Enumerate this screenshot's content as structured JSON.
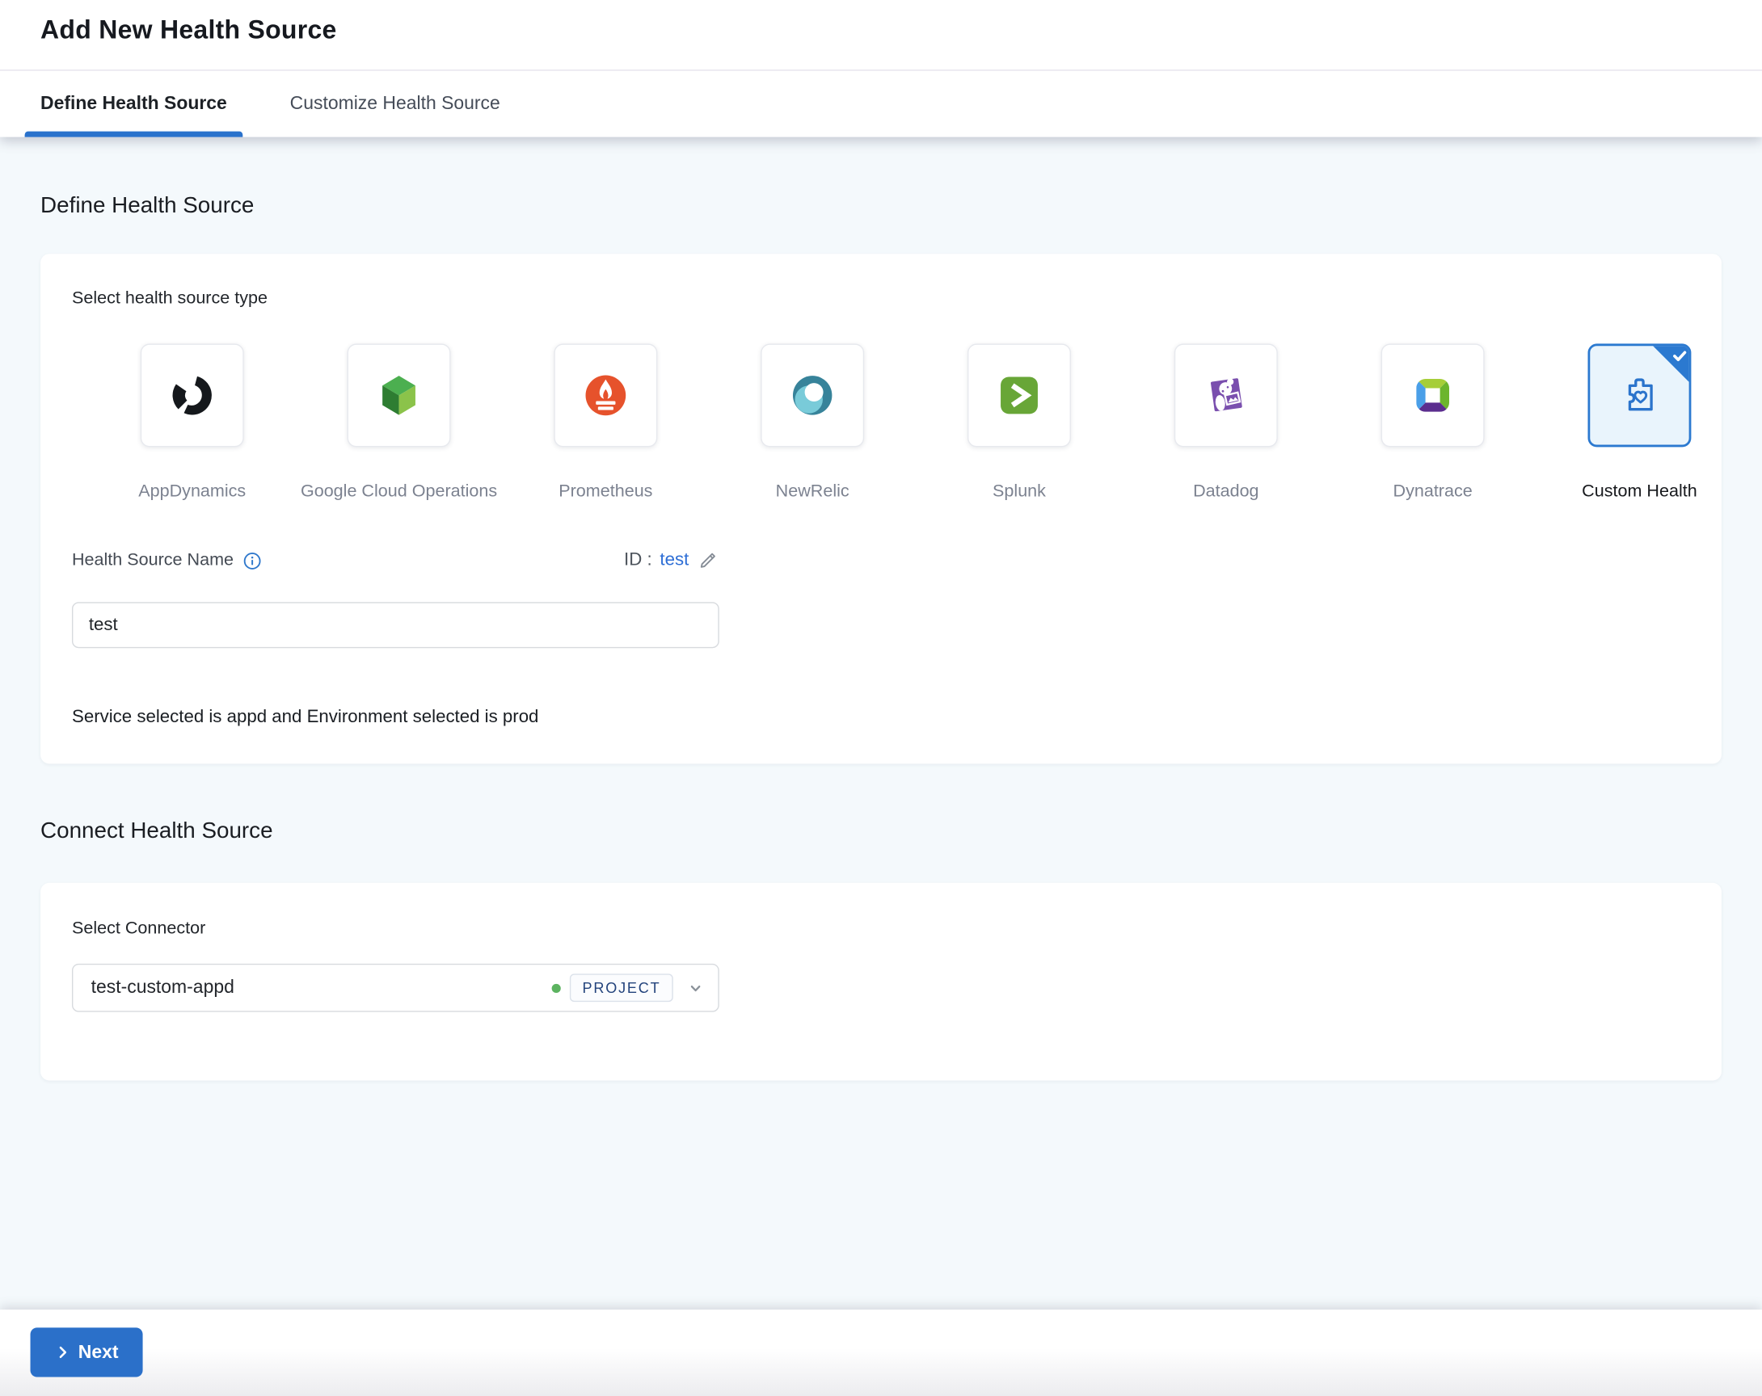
{
  "header": {
    "title": "Add New Health Source",
    "tabs": [
      {
        "label": "Define Health Source",
        "active": true
      },
      {
        "label": "Customize Health Source",
        "active": false
      }
    ]
  },
  "define_section": {
    "heading": "Define Health Source",
    "select_type_label": "Select health source type",
    "source_types": [
      {
        "label": "AppDynamics",
        "icon": "appdynamics-icon",
        "selected": false
      },
      {
        "label": "Google Cloud Operations",
        "icon": "google-cloud-operations-icon",
        "selected": false
      },
      {
        "label": "Prometheus",
        "icon": "prometheus-icon",
        "selected": false
      },
      {
        "label": "NewRelic",
        "icon": "newrelic-icon",
        "selected": false
      },
      {
        "label": "Splunk",
        "icon": "splunk-icon",
        "selected": false
      },
      {
        "label": "Datadog",
        "icon": "datadog-icon",
        "selected": false
      },
      {
        "label": "Dynatrace",
        "icon": "dynatrace-icon",
        "selected": false
      },
      {
        "label": "Custom Health",
        "icon": "custom-health-icon",
        "selected": true
      }
    ],
    "name_label": "Health Source Name",
    "name_value": "test",
    "id_label": "ID :",
    "id_value": "test",
    "service_env_note": "Service selected is appd and Environment selected is prod"
  },
  "connect_section": {
    "heading": "Connect Health Source",
    "select_connector_label": "Select Connector",
    "connector": {
      "name": "test-custom-appd",
      "scope_badge": "PROJECT",
      "status_dot_color": "#5cb360"
    }
  },
  "footer": {
    "next_label": "Next"
  },
  "colors": {
    "primary_blue": "#2b70c9",
    "selected_tile_border": "#2b79d0",
    "selected_tile_fill": "#e9f4fc",
    "link_blue": "#2f6fd6",
    "page_background": "#f4f9fc",
    "badge_text": "#23437c",
    "tile_label_gray": "#7c8290"
  }
}
